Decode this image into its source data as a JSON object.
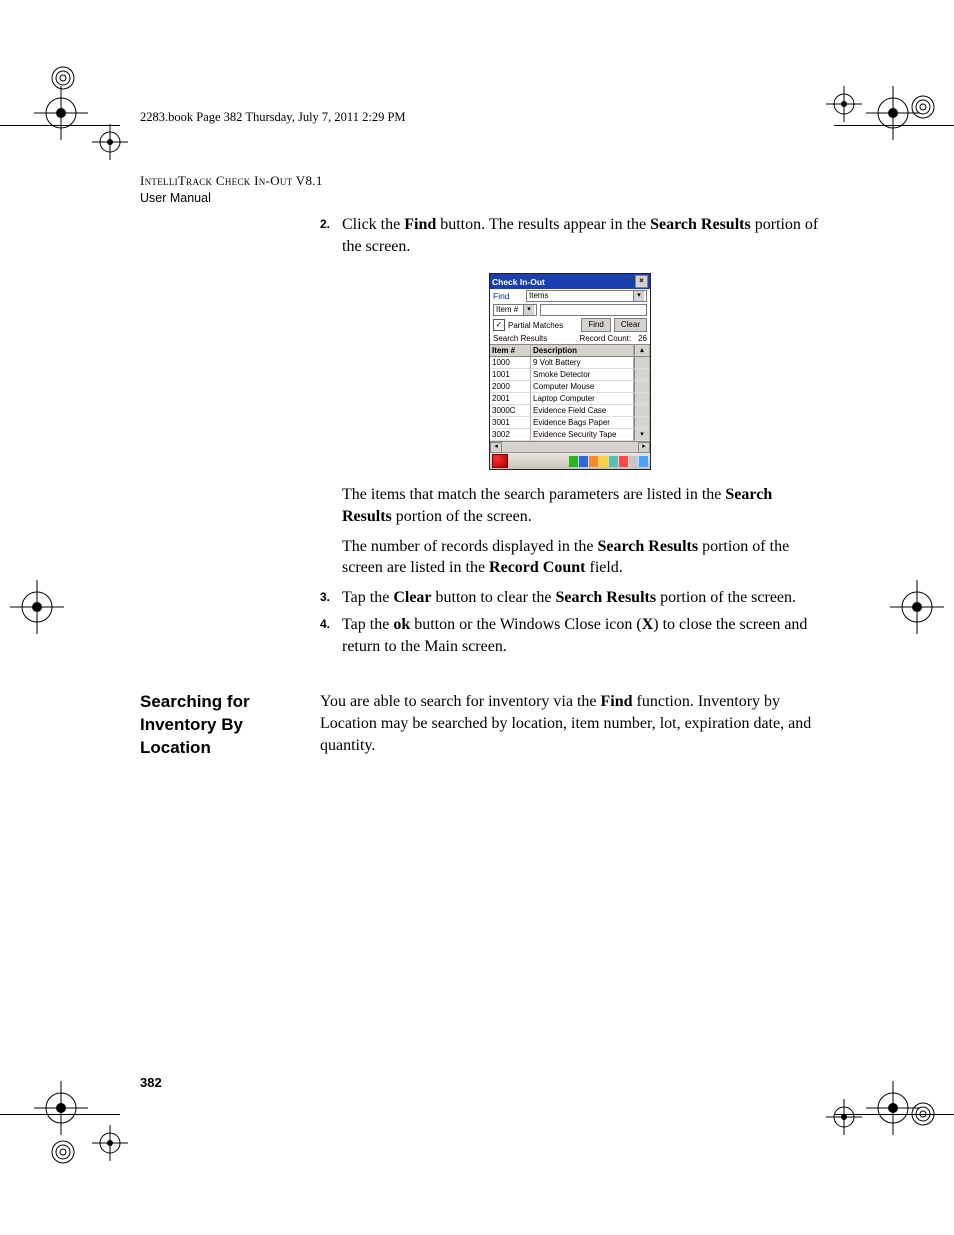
{
  "crop_header": "2283.book  Page 382  Thursday, July 7, 2011  2:29 PM",
  "header": {
    "line1": "IntelliTrack Check In-Out V8.1",
    "line2": "User Manual"
  },
  "steps_upper": [
    {
      "num": "2.",
      "parts": [
        "Click the ",
        "Find",
        " button. The results appear in the ",
        "Search Results",
        " portion of the screen."
      ]
    }
  ],
  "figure": {
    "title": "Check In-Out",
    "find_label": "Find",
    "find_dropdown": "Items",
    "field_label": "Item #",
    "partial_label": "Partial Matches",
    "find_btn": "Find",
    "clear_btn": "Clear",
    "search_results_label": "Search Results",
    "record_count_label": "Record Count:",
    "record_count_value": "26",
    "columns": {
      "item": "Item #",
      "desc": "Description"
    },
    "rows": [
      {
        "item": "1000",
        "desc": "9 Volt Battery"
      },
      {
        "item": "1001",
        "desc": "Smoke Detector"
      },
      {
        "item": "2000",
        "desc": "Computer Mouse"
      },
      {
        "item": "2001",
        "desc": "Laptop Computer"
      },
      {
        "item": "3000C",
        "desc": "Evidence Field Case"
      },
      {
        "item": "3001",
        "desc": "Evidence Bags Paper"
      },
      {
        "item": "3002",
        "desc": "Evidence Security Tape"
      }
    ]
  },
  "after_figure": [
    {
      "parts": [
        "The items that match the search parameters are listed in the ",
        "Search Results",
        " portion of the screen."
      ]
    },
    {
      "parts": [
        "The number of records displayed in the ",
        "Search Results",
        " portion of the screen are listed in the ",
        "Record Count",
        " field."
      ]
    }
  ],
  "steps_lower": [
    {
      "num": "3.",
      "parts": [
        "Tap the ",
        "Clear",
        " button to clear the ",
        "Search Results",
        " portion of the screen."
      ]
    },
    {
      "num": "4.",
      "parts": [
        "Tap the ",
        "ok",
        " button or the Windows Close icon (",
        "X",
        ") to close the screen and return to the Main screen."
      ]
    }
  ],
  "section_heading": "Searching for Inventory By Location",
  "section_body": {
    "parts": [
      "You are able to search for inventory via the ",
      "Find",
      " function. Inventory by Location may be searched by location, item number, lot, expiration date, and quantity."
    ]
  },
  "page_number": "382"
}
